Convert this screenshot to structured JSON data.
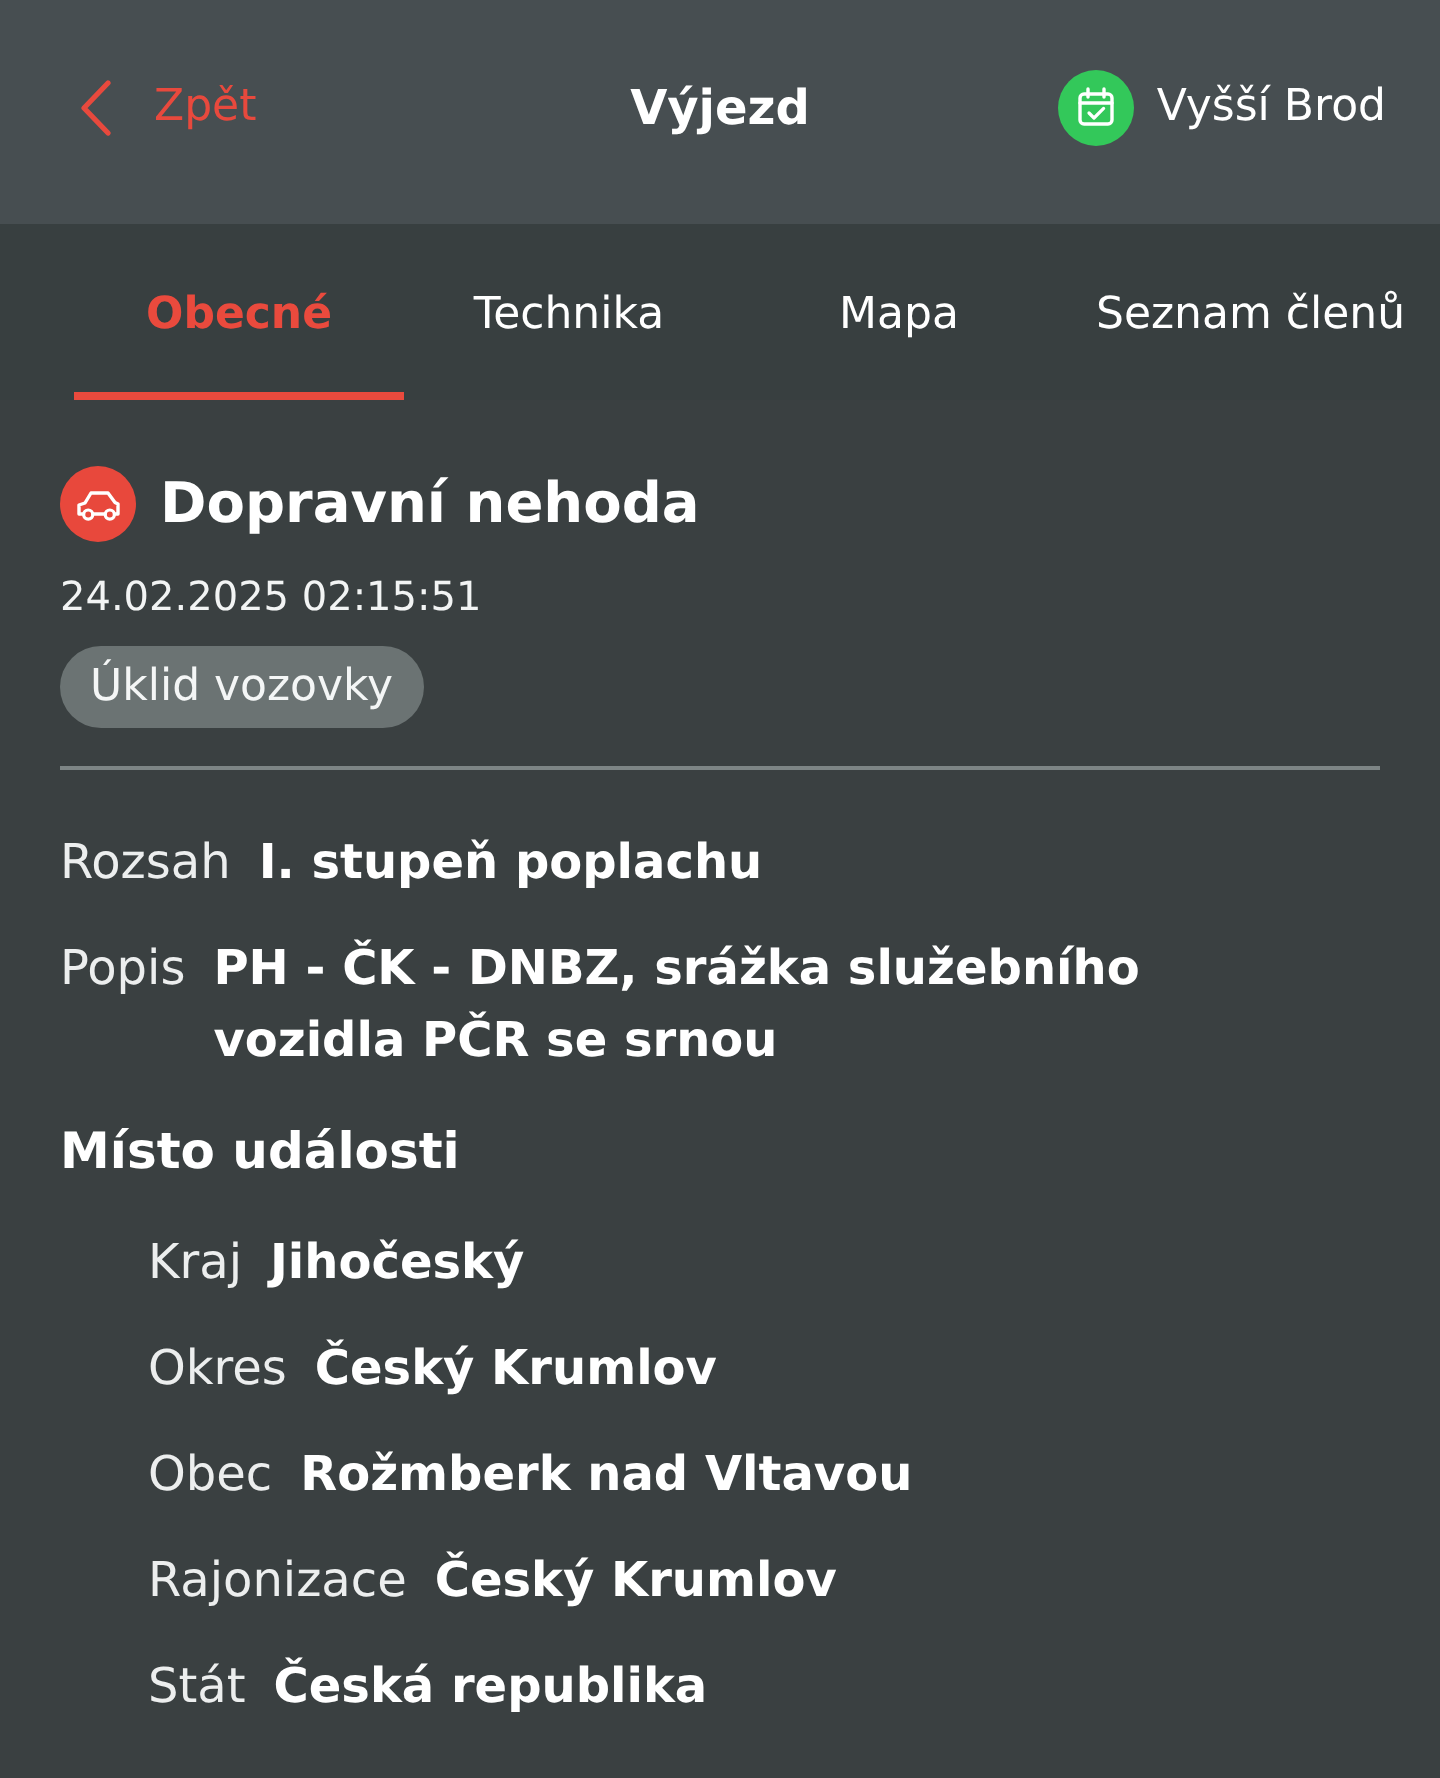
{
  "header": {
    "back_label": "Zpět",
    "title": "Výjezd",
    "unit": "Vyšší Brod"
  },
  "tabs": [
    {
      "label": "Obecné",
      "selected": true
    },
    {
      "label": "Technika",
      "selected": false
    },
    {
      "label": "Mapa",
      "selected": false
    },
    {
      "label": "Seznam členů",
      "selected": false
    }
  ],
  "incident": {
    "type": "Dopravní nehoda",
    "datetime": "24.02.2025 02:15:51",
    "tags": [
      "Úklid vozovky"
    ]
  },
  "details": [
    {
      "label": "Rozsah",
      "value": "I. stupeň poplachu"
    },
    {
      "label": "Popis",
      "value": "PH - ČK - DNBZ, srážka služebního vozidla PČR se srnou"
    }
  ],
  "location": {
    "title": "Místo události",
    "fields": [
      {
        "label": "Kraj",
        "value": "Jihočeský"
      },
      {
        "label": "Okres",
        "value": "Český Krumlov"
      },
      {
        "label": "Obec",
        "value": "Rožmberk nad Vltavou"
      },
      {
        "label": "Rajonizace",
        "value": "Český Krumlov"
      },
      {
        "label": "Stát",
        "value": "Česká republika"
      }
    ]
  }
}
